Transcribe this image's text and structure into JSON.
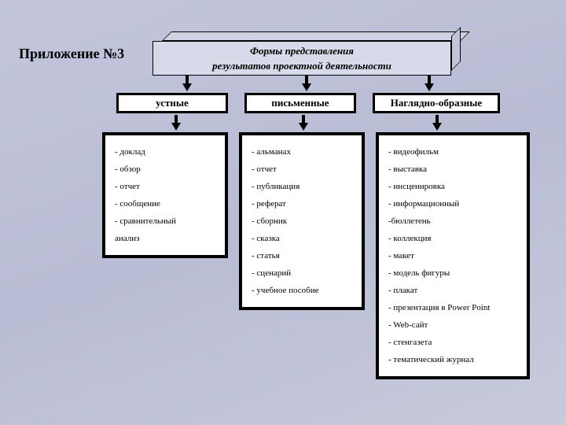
{
  "page_title": "Приложение №3",
  "header": {
    "line1": "Формы представления",
    "line2": "результатов проектной деятельности"
  },
  "columns": [
    {
      "header": "устные",
      "items": [
        {
          "t": "доклад",
          "dash": true
        },
        {
          "t": "обзор",
          "dash": true
        },
        {
          "t": "отчет",
          "dash": true
        },
        {
          "t": "сообщение",
          "dash": true
        },
        {
          "t": "сравнительный",
          "dash": true
        },
        {
          "t": "анализ",
          "dash": false
        }
      ]
    },
    {
      "header": "письменные",
      "items": [
        {
          "t": "альманах",
          "dash": true
        },
        {
          "t": "отчет",
          "dash": true
        },
        {
          "t": "публикация",
          "dash": true
        },
        {
          "t": "реферат",
          "dash": true
        },
        {
          "t": "сборник",
          "dash": true
        },
        {
          "t": "сказка",
          "dash": true
        },
        {
          "t": "статья",
          "dash": true
        },
        {
          "t": "сценарий",
          "dash": true
        },
        {
          "t": "учебное пособие",
          "dash": true
        }
      ]
    },
    {
      "header": "Наглядно-образные",
      "items": [
        {
          "t": "видеофильм",
          "dash": true
        },
        {
          "t": "выставка",
          "dash": true
        },
        {
          "t": "инсценировка",
          "dash": true
        },
        {
          "t": "информационный",
          "dash": true
        },
        {
          "t": "бюллетень",
          "dash": false,
          "prefix": "-"
        },
        {
          "t": "коллекция",
          "dash": true
        },
        {
          "t": "макет",
          "dash": true
        },
        {
          "t": "модель фигуры",
          "dash": true
        },
        {
          "t": "плакат",
          "dash": true
        },
        {
          "t": "презентация в Power Point",
          "dash": true
        },
        {
          "t": "Web-сайт",
          "dash": true
        },
        {
          "t": "стенгазета",
          "dash": true
        },
        {
          "t": "тематический журнал",
          "dash": true
        }
      ]
    }
  ]
}
